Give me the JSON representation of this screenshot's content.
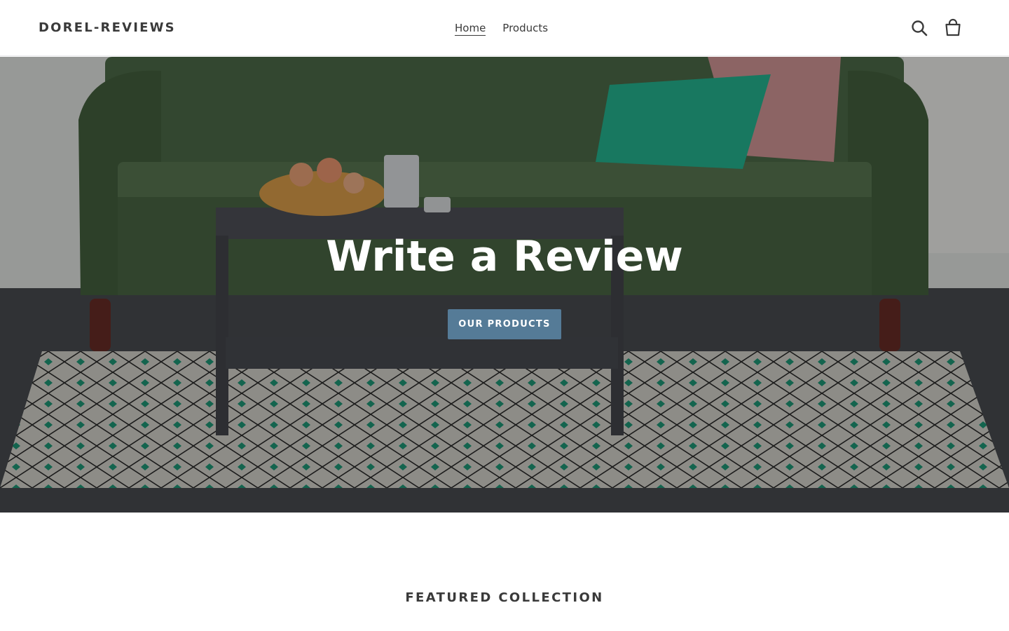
{
  "header": {
    "logo": "DOREL-REVIEWS",
    "nav": [
      {
        "label": "Home",
        "active": true
      },
      {
        "label": "Products",
        "active": false
      }
    ],
    "icons": [
      "search-icon",
      "cart-icon"
    ]
  },
  "hero": {
    "title": "Write a Review",
    "button_label": "OUR PRODUCTS",
    "button_color": "#557b97",
    "image": "green-futon-sofa-coffee-table-rug-scene"
  },
  "featured": {
    "title": "FEATURED COLLECTION"
  },
  "colors": {
    "text": "#3a3a3a",
    "accent": "#557b97",
    "background": "#ffffff"
  }
}
